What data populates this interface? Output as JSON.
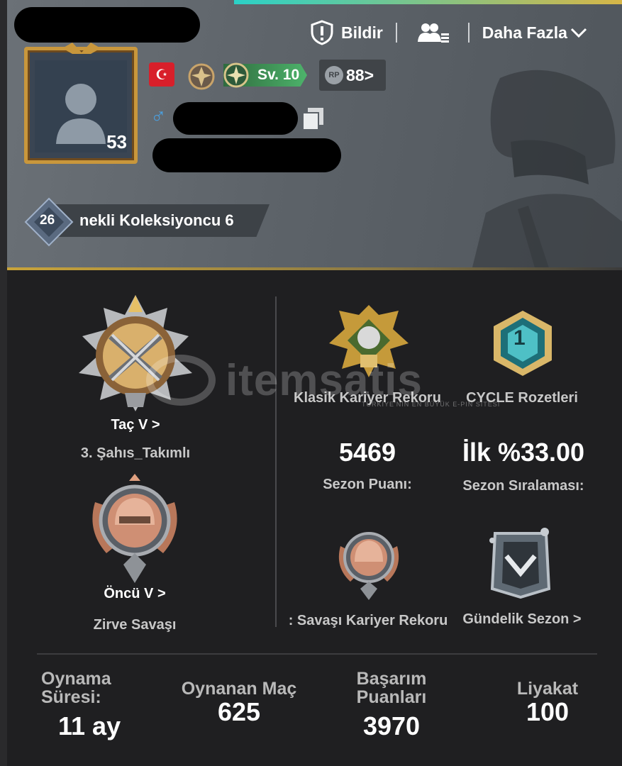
{
  "header": {
    "actions": [
      {
        "label": "Bildir",
        "icon": "shield-alert-icon"
      },
      {
        "label": "",
        "icon": "friends-list-icon"
      },
      {
        "label": "Daha Fazla",
        "icon": "chevron-down-icon"
      }
    ],
    "avatar_level": "53",
    "flag_icon": "turkey-flag-icon",
    "level_badge": "Sv. 10",
    "rp_value": "88>",
    "rp_icon_text": "RP",
    "title_level": "26",
    "title_text": "nekli Koleksiyoncu 6"
  },
  "left_panel": {
    "tier1_name": "Taç V >",
    "tier1_mode": "3. Şahıs_Takımlı",
    "tier2_name": "Öncü V >",
    "tier2_mode": "Zirve Savaşı"
  },
  "right_panel": {
    "classic_label": "Klasik Kariyer Rekoru",
    "cycle_label": "CYCLE Rozetleri",
    "cycle_number": "1",
    "season_points_value": "5469",
    "season_points_label": "Sezon Puanı:",
    "season_rank_value": "İlk %33.00",
    "season_rank_label": "Sezon Sıralaması:",
    "summit_label": ": Savaşı Kariyer Rekoru",
    "casual_label": "Gündelik Sezon >"
  },
  "stats": [
    {
      "label_line1": "Oynama",
      "label_line2": "Süresi:",
      "value": "11 ay"
    },
    {
      "label_line1": "Oynanan Maç",
      "label_line2": "",
      "value": "625"
    },
    {
      "label_line1": "Başarım",
      "label_line2": "Puanları",
      "value": "3970"
    },
    {
      "label_line1": "Liyakat",
      "label_line2": "",
      "value": "100"
    }
  ],
  "watermark": {
    "text": "itemsatis",
    "sub": "TÜRKİYE'NİN EN BÜYÜK E-PIN SİTESİ"
  },
  "colors": {
    "gold": "#c9973c",
    "green": "#4db36b",
    "accent": "#2bd1c7"
  }
}
